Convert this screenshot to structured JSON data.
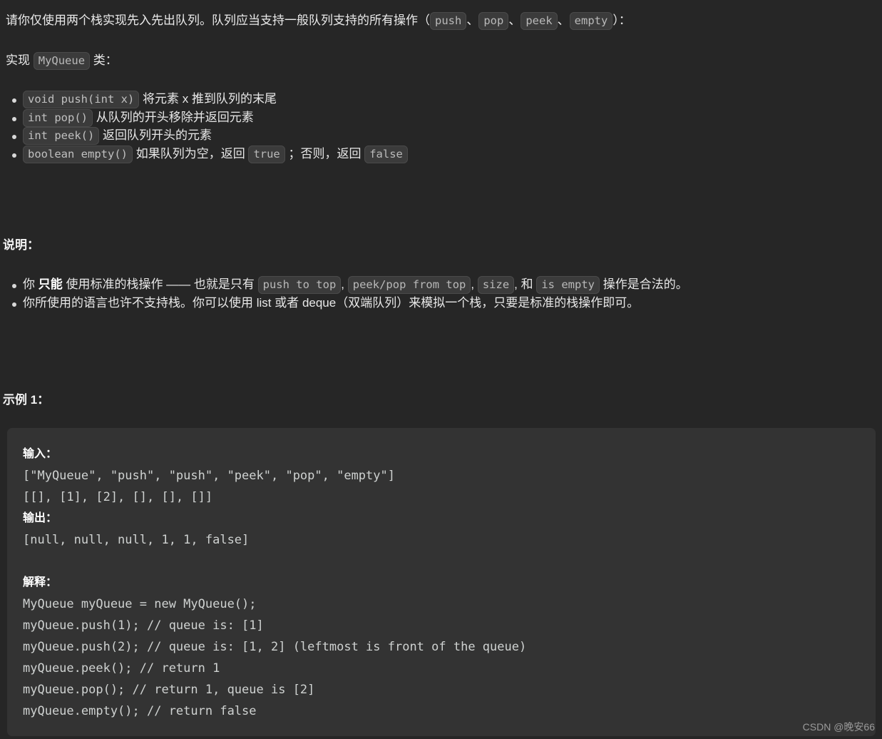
{
  "theme": {
    "page_background": "#262626",
    "text_color": "#eaeaea",
    "chip_background": "#3b3b3b",
    "chip_border": "#4a4a4a",
    "chip_text": "#b9b9b9",
    "codeblock_background": "#333333",
    "code_text": "#cfd2d1",
    "watermark_color": "#9a9a9a"
  },
  "intro": {
    "part1": "请你仅使用两个栈实现先入先出队列。队列应当支持一般队列支持的所有操作（",
    "chip_push": "push",
    "sep1": "、",
    "chip_pop": "pop",
    "sep2": "、",
    "chip_peek": "peek",
    "sep3": "、",
    "chip_empty": "empty",
    "part2": "）："
  },
  "implement": {
    "prefix": "实现 ",
    "chip_class": "MyQueue",
    "suffix": " 类："
  },
  "api_items": [
    {
      "signature": "void push(int x)",
      "text": " 将元素 x 推到队列的末尾"
    },
    {
      "signature": "int pop()",
      "text": " 从队列的开头移除并返回元素"
    },
    {
      "signature": "int peek()",
      "text": " 返回队列开头的元素"
    }
  ],
  "api_empty": {
    "signature": "boolean empty()",
    "text_before": " 如果队列为空，返回 ",
    "chip_true": "true",
    "text_middle": " ；否则，返回 ",
    "chip_false": "false"
  },
  "headings": {
    "shuoming": "说明：",
    "shili": "示例 1："
  },
  "notes": {
    "note1": {
      "a": "你 ",
      "bold": "只能",
      "b": " 使用标准的栈操作 —— 也就是只有 ",
      "chip1": "push to top",
      "c": ", ",
      "chip2": "peek/pop from top",
      "d": ", ",
      "chip3": "size",
      "e": ", 和 ",
      "chip4": "is empty",
      "f": " 操作是合法的。"
    },
    "note2": "你所使用的语言也许不支持栈。你可以使用 list 或者 deque（双端队列）来模拟一个栈，只要是标准的栈操作即可。"
  },
  "example": {
    "input_label": "输入：",
    "input_line1": "[\"MyQueue\", \"push\", \"push\", \"peek\", \"pop\", \"empty\"]",
    "input_line2": "[[], [1], [2], [], [], []]",
    "output_label": "输出：",
    "output_line1": "[null, null, null, 1, 1, false]",
    "explain_label": "解释：",
    "explain_lines": [
      "MyQueue myQueue = new MyQueue();",
      "myQueue.push(1); // queue is: [1]",
      "myQueue.push(2); // queue is: [1, 2] (leftmost is front of the queue)",
      "myQueue.peek(); // return 1",
      "myQueue.pop(); // return 1, queue is [2]",
      "myQueue.empty(); // return false"
    ]
  },
  "watermark": "CSDN @晚安66"
}
